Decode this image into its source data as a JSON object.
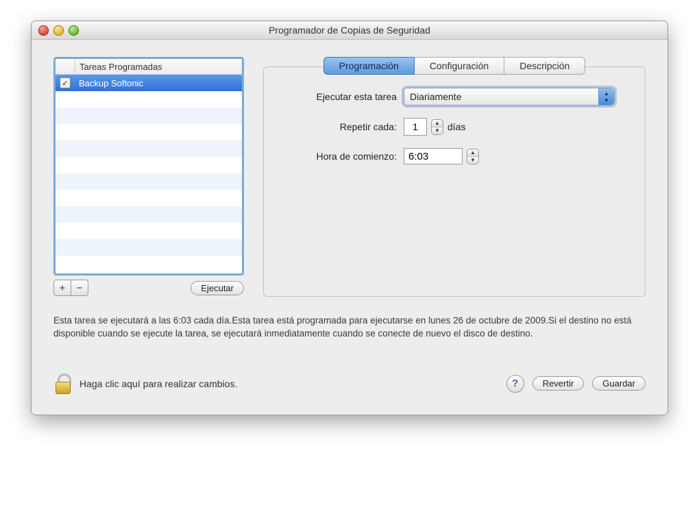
{
  "window": {
    "title": "Programador de Copias de Seguridad"
  },
  "sidebar": {
    "header": "Tareas Programadas",
    "items": [
      {
        "label": "Backup Softonic",
        "checked": true,
        "selected": true
      }
    ],
    "add_label": "+",
    "remove_label": "−",
    "run_label": "Ejecutar"
  },
  "tabs": {
    "programming": "Programación",
    "configuration": "Configuración",
    "description": "Descripción",
    "selected": "programming"
  },
  "form": {
    "run_task_label": "Ejecutar esta tarea",
    "run_task_value": "Diariamente",
    "repeat_label": "Repetir cada:",
    "repeat_value": "1",
    "repeat_unit": "días",
    "start_time_label": "Hora de comienzo:",
    "start_time_value": "6:03"
  },
  "description_text": "Esta tarea se ejecutará a las 6:03 cada día.Esta tarea está programada para ejecutarse en lunes 26 de octubre de 2009.Si el destino no está disponible cuando se ejecute la tarea, se ejecutará inmediatamente cuando se conecte de nuevo el disco de destino.",
  "footer": {
    "lock_text": "Haga clic aquí para realizar cambios.",
    "help_label": "?",
    "revert_label": "Revertir",
    "save_label": "Guardar"
  }
}
